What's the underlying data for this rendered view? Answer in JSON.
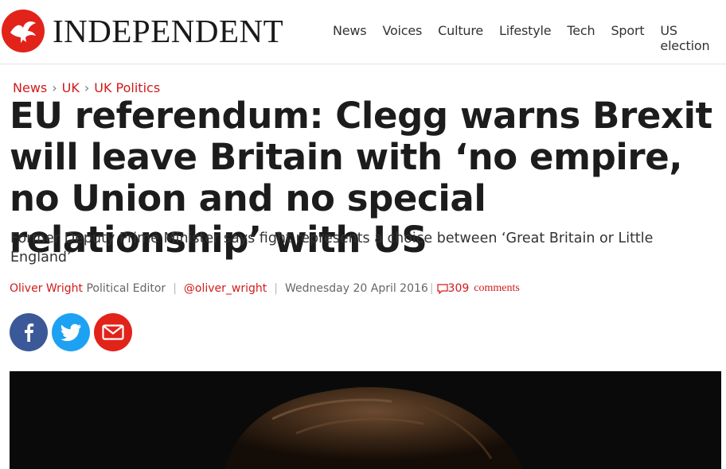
{
  "header": {
    "brand": "INDEPENDENT",
    "nav": [
      "News",
      "Voices",
      "Culture",
      "Lifestyle",
      "Tech",
      "Sport",
      "US election"
    ]
  },
  "breadcrumb": [
    "News",
    "UK",
    "UK Politics"
  ],
  "article": {
    "headline": "EU referendum: Clegg warns Brexit will leave Britain with ‘no empire, no Union and no special relationship’ with US",
    "standfirst": "Former Deputy Prime Minister says fight represents a choice between ‘Great Britain or Little England’",
    "byline": {
      "author": "Oliver Wright",
      "role": "Political Editor",
      "handle": "@oliver_wright",
      "date": "Wednesday 20 April 2016",
      "comment_count": "309",
      "comments_label": "comments"
    }
  },
  "share": {
    "icons": [
      "facebook-icon",
      "twitter-icon",
      "email-icon"
    ]
  },
  "colors": {
    "brand_red": "#e2231a",
    "link_red": "#d11a1a",
    "facebook": "#3b5998",
    "twitter": "#1da1f2"
  }
}
